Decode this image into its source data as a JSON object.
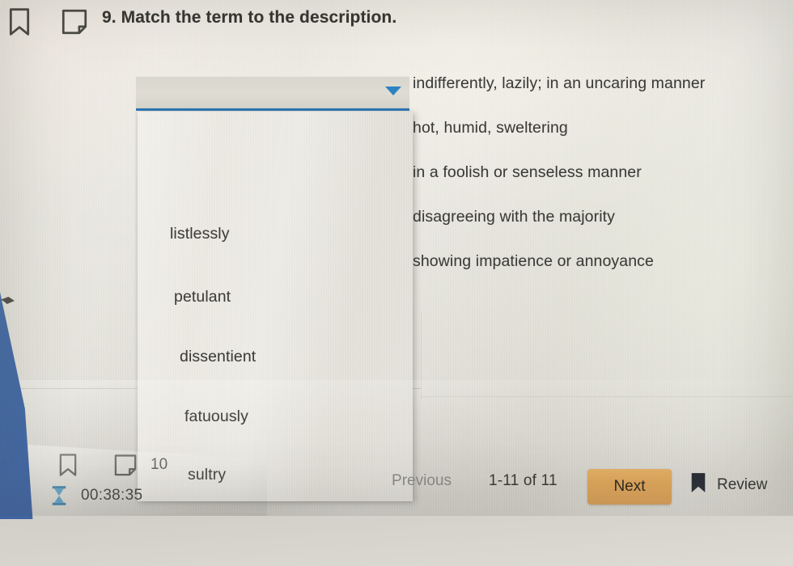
{
  "header": {
    "bookmark_icon": "bookmark-outline-icon",
    "note_icon": "note-icon",
    "question_number": "9.",
    "question_text": "Match the term to the description."
  },
  "select": {
    "value": "",
    "placeholder": "",
    "caret_icon": "chevron-down-icon",
    "accent_color": "#2e77b5"
  },
  "dropdown": {
    "open": true,
    "options": [
      {
        "label": "listlessly"
      },
      {
        "label": "petulant"
      },
      {
        "label": "dissentient"
      },
      {
        "label": "fatuously"
      },
      {
        "label": "sultry"
      }
    ]
  },
  "descriptions": [
    "indifferently, lazily; in an uncaring manner",
    "hot, humid, sweltering",
    "in a foolish or senseless manner",
    "disagreeing with the majority",
    "showing impatience or annoyance"
  ],
  "bottom": {
    "row_bookmark_icon": "bookmark-outline-icon",
    "row_note_icon": "note-icon",
    "row_question_number": "10",
    "timer_icon": "hourglass-icon",
    "timer": "00:38:35",
    "previous_label": "Previous",
    "pager": "1-11 of 11",
    "next_label": "Next",
    "review_label": "Review",
    "review_icon": "bookmark-filled-icon",
    "next_color": "#e2a85c"
  }
}
